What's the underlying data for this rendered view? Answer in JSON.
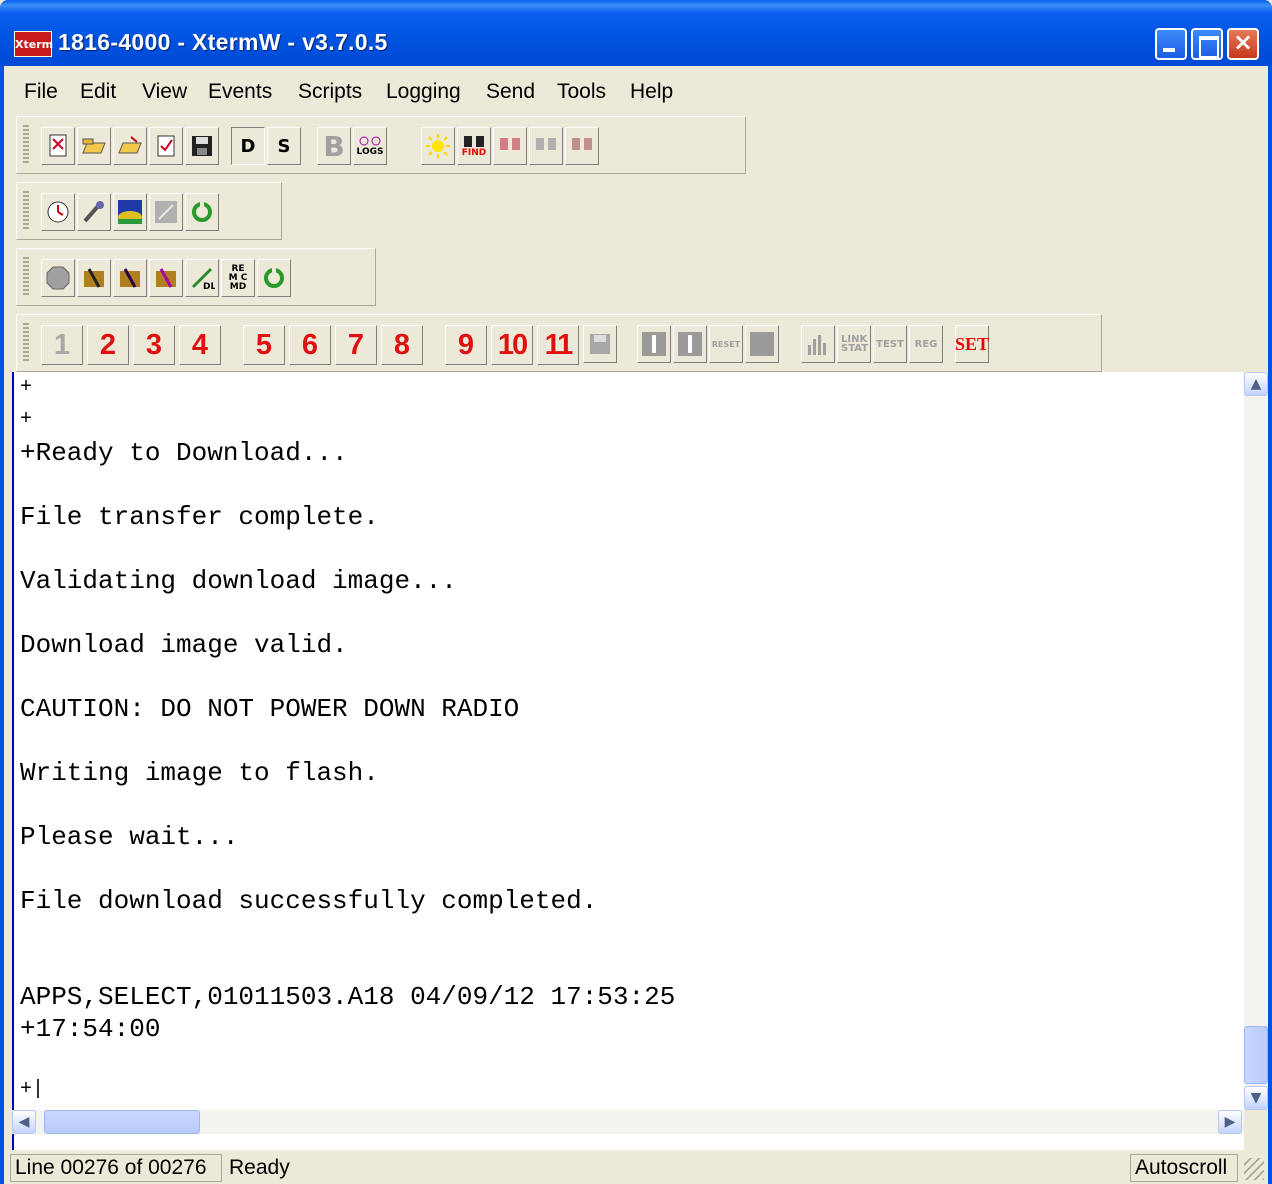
{
  "window": {
    "title": "1816-4000 - XtermW - v3.7.0.5",
    "icon_label": "Xterm",
    "controls": {
      "minimize": "minimize-icon",
      "maximize": "maximize-icon",
      "close": "×"
    }
  },
  "menu": [
    "File",
    "Edit",
    "View",
    "Events",
    "Scripts",
    "Logging",
    "Send",
    "Tools",
    "Help"
  ],
  "toolbar1": {
    "buttons": [
      "new-icon",
      "open-icon",
      "open-folder-icon",
      "checklist-icon",
      "save-icon"
    ],
    "d_label": "D",
    "s_label": "S",
    "b_label": "B",
    "logs_label": "LOGS",
    "find_label": "FIND"
  },
  "toolbar2": {
    "buttons": [
      "clock-icon",
      "wrench-icon",
      "landscape-icon",
      "disabled-icon",
      "refresh-icon"
    ]
  },
  "toolbar3": {
    "stop_label": "STOP",
    "dl_label": "DL",
    "rem_cmd_label": "REM CMD"
  },
  "toolbar4": {
    "numbers": [
      "1",
      "2",
      "3",
      "4",
      "5",
      "6",
      "7",
      "8",
      "9",
      "10",
      "11"
    ],
    "reset_label": "RESET",
    "link_stat_label": "LINK STAT",
    "test_label": "TEST",
    "reg_label": "REG",
    "set_label": "SET"
  },
  "terminal": {
    "lines": [
      "+",
      "+",
      "+Ready to Download...",
      "File transfer complete.",
      "Validating download image...",
      "Download image valid.",
      "CAUTION: DO NOT POWER DOWN RADIO",
      "Writing image to flash.",
      "Please wait...",
      "File download successfully completed.",
      "APPS,SELECT,01011503.A18 04/09/12 17:53:25",
      "+17:54:00",
      "+|"
    ]
  },
  "status": {
    "line": "Line 00276 of 00276",
    "state": "Ready",
    "mode": "Autoscroll"
  },
  "colors": {
    "titlebar": "#0054e3",
    "number_button_text": "#e01010",
    "terminal_border": "#0000c8"
  }
}
